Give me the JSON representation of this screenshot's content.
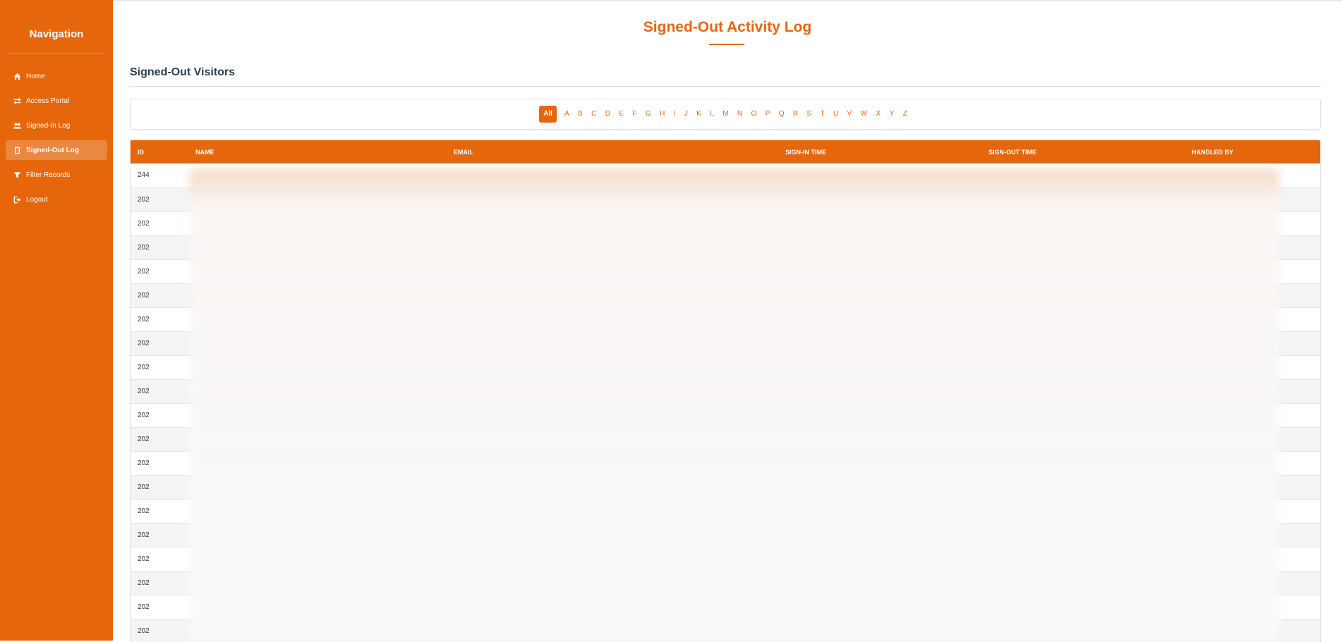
{
  "sidebar": {
    "title": "Navigation",
    "items": [
      {
        "label": "Home",
        "icon": "home-icon",
        "active": false
      },
      {
        "label": "Access Portal",
        "icon": "exchange-icon",
        "active": false
      },
      {
        "label": "Signed-In Log",
        "icon": "users-icon",
        "active": false
      },
      {
        "label": "Signed-Out Log",
        "icon": "door-icon",
        "active": true
      },
      {
        "label": "Filter Records",
        "icon": "filter-icon",
        "active": false
      },
      {
        "label": "Logout",
        "icon": "logout-icon",
        "active": false
      }
    ]
  },
  "header": {
    "title": "Signed-Out Activity Log",
    "section_title": "Signed-Out Visitors"
  },
  "alphabet": {
    "active": "All",
    "letters": [
      "All",
      "A",
      "B",
      "C",
      "D",
      "E",
      "F",
      "G",
      "H",
      "I",
      "J",
      "K",
      "L",
      "M",
      "N",
      "O",
      "P",
      "Q",
      "R",
      "S",
      "T",
      "U",
      "V",
      "W",
      "X",
      "Y",
      "Z"
    ]
  },
  "table": {
    "columns": [
      "ID",
      "NAME",
      "EMAIL",
      "SIGN-IN TIME",
      "SIGN-OUT TIME",
      "HANDLED BY"
    ],
    "rows": [
      {
        "id": "244"
      },
      {
        "id": "202"
      },
      {
        "id": "202"
      },
      {
        "id": "202"
      },
      {
        "id": "202"
      },
      {
        "id": "202"
      },
      {
        "id": "202"
      },
      {
        "id": "202"
      },
      {
        "id": "202"
      },
      {
        "id": "202"
      },
      {
        "id": "202"
      },
      {
        "id": "202"
      },
      {
        "id": "202"
      },
      {
        "id": "202"
      },
      {
        "id": "202"
      },
      {
        "id": "202"
      },
      {
        "id": "202"
      },
      {
        "id": "202"
      },
      {
        "id": "202"
      },
      {
        "id": "202"
      }
    ]
  },
  "colors": {
    "accent": "#e5660b",
    "heading": "#2c3e50"
  }
}
